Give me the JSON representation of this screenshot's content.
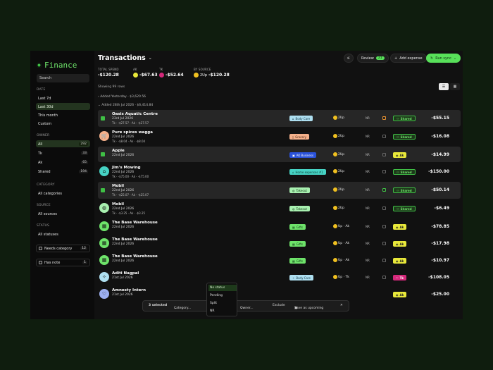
{
  "app": {
    "name": "Finance"
  },
  "sidebar": {
    "search_placeholder": "Search",
    "date_label": "DATE",
    "date_items": [
      "Last 7d",
      "Last 30d",
      "This month",
      "Custom"
    ],
    "owner_label": "OWNER",
    "owner_items": [
      {
        "label": "All",
        "count": "292"
      },
      {
        "label": "Tk",
        "count": "33"
      },
      {
        "label": "Ak",
        "count": "65"
      },
      {
        "label": "Shared",
        "count": "194"
      }
    ],
    "category_label": "CATEGORY",
    "category_value": "All categories",
    "source_label": "SOURCE",
    "source_value": "All sources",
    "status_label": "STATUS",
    "status_value": "All statuses",
    "needs_category": {
      "label": "Needs category",
      "count": "12"
    },
    "has_note": {
      "label": "Has note",
      "count": "1"
    }
  },
  "header": {
    "title": "Transactions",
    "review": "Review",
    "review_count": "21",
    "add_expense": "Add expense",
    "run_sync": "Run sync",
    "stats": {
      "total_label": "TOTAL SPEND",
      "total_value": "-$120.28",
      "ak_label": "AK",
      "ak_value": "-$67.63",
      "tk_label": "TK",
      "tk_value": "-$52.64",
      "source_label": "BY SOURCE",
      "source_name": "2Up",
      "source_value": "-$120.28"
    },
    "showing": "Showing 99 rows",
    "group1": "Added Yesterday · $3,620.56",
    "group2": "Added 28th Jul 2026 · $6,414.84"
  },
  "rows": [
    {
      "name": "Oasis Aquatic Centre",
      "date": "23rd Jul 2026",
      "split": "Tk · -$27.57 · Ak · -$27.57",
      "category": "Body Care",
      "owner": "2Up",
      "status": "NR",
      "tag": "Shared",
      "amount": "-$55.15",
      "icon": "checkbox"
    },
    {
      "name": "Pure spices wagga",
      "date": "22nd Jul 2026",
      "split": "Tk · -$8.04 · Ak · -$8.04",
      "category": "Grocery",
      "owner": "2Up",
      "status": "NR",
      "tag": "Shared",
      "amount": "-$16.08",
      "icon": "cart-icon"
    },
    {
      "name": "Apple",
      "date": "22nd Jul 2026",
      "split": "",
      "category": "AK Business",
      "owner": "2Up",
      "status": "NR",
      "tag": "Ak",
      "amount": "-$14.99",
      "icon": "checkbox"
    },
    {
      "name": "Jim's Mowing",
      "date": "22nd Jul 2026",
      "split": "Tk · -$75.00 · Ak · -$75.00",
      "category": "Home expenses #1",
      "owner": "2Up",
      "status": "NR",
      "tag": "Shared",
      "amount": "-$150.00",
      "icon": "home-icon"
    },
    {
      "name": "Mobil",
      "date": "22nd Jul 2026",
      "split": "Tk · -$25.07 · Ak · -$25.07",
      "category": "Takeout",
      "owner": "2Up",
      "status": "NR",
      "tag": "Shared",
      "amount": "-$50.14",
      "icon": "checkbox"
    },
    {
      "name": "Mobil",
      "date": "22nd Jul 2026",
      "split": "Tk · -$3.25 · Ak · -$3.25",
      "category": "Takeout",
      "owner": "2Up",
      "status": "NR",
      "tag": "Shared",
      "amount": "-$6.49",
      "icon": "takeout-icon"
    },
    {
      "name": "The Base Warehouse",
      "date": "22nd Jul 2026",
      "split": "",
      "category": "Gifts",
      "owner": "Up · Ak",
      "status": "NR",
      "tag": "Ak",
      "amount": "-$78.85",
      "icon": "gift-icon"
    },
    {
      "name": "The Base Warehouse",
      "date": "22nd Jul 2026",
      "split": "",
      "category": "Gifts",
      "owner": "Up · Ak",
      "status": "NR",
      "tag": "Ak",
      "amount": "-$17.98",
      "icon": "gift-icon"
    },
    {
      "name": "The Base Warehouse",
      "date": "22nd Jul 2026",
      "split": "",
      "category": "Gifts",
      "owner": "Up · Ak",
      "status": "NR",
      "tag": "Ak",
      "amount": "-$10.97",
      "icon": "gift-icon"
    },
    {
      "name": "Aditi Nagpal",
      "date": "21st Jul 2026",
      "split": "",
      "category": "Body Care",
      "owner": "Up · Tk",
      "status": "NR",
      "tag": "Tk",
      "amount": "-$108.05",
      "icon": "sparkle-icon"
    },
    {
      "name": "Amnesty Intern",
      "date": "21st Jul 2026",
      "split": "",
      "category": "",
      "owner": "",
      "status": "",
      "tag": "Ak",
      "amount": "-$25.00",
      "icon": "heart-icon"
    }
  ],
  "bulkbar": {
    "selected": "3 selected",
    "category": "Category...",
    "owner": "Owner...",
    "exclude": "Exclude",
    "save": "Save as upcoming"
  },
  "status_menu": [
    "No status",
    "Pending",
    "Split",
    "NR"
  ],
  "colors": {
    "accent": "#58e05a",
    "background": "#0f1d0e"
  }
}
